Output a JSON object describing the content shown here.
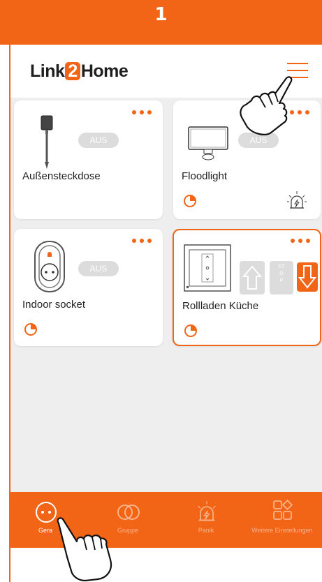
{
  "step": {
    "number": "1"
  },
  "header": {
    "logo_left": "Link",
    "logo_badge": "2",
    "logo_right": "Home"
  },
  "devices": [
    {
      "name": "Außensteckdose",
      "status": "AUS",
      "icon": "outdoor-socket-icon"
    },
    {
      "name": "Floodlight",
      "status": "AUS",
      "icon": "floodlight-icon"
    },
    {
      "name": "Indoor socket",
      "status": "AUS",
      "icon": "indoor-socket-icon"
    },
    {
      "name": "Rollladen Küche",
      "stop_label": "STOP",
      "icon": "shutter-switch-icon"
    }
  ],
  "nav": {
    "items": [
      {
        "label": "Gera",
        "icon": "devices-icon",
        "active": true
      },
      {
        "label": "Gruppe",
        "icon": "group-icon"
      },
      {
        "label": "Panik",
        "icon": "panic-alarm-icon"
      },
      {
        "label": "Weitere Einstellungen",
        "icon": "settings-grid-icon"
      }
    ]
  },
  "colors": {
    "accent": "#f26416",
    "background": "#eeeeee",
    "pill": "#dcdcdc"
  }
}
